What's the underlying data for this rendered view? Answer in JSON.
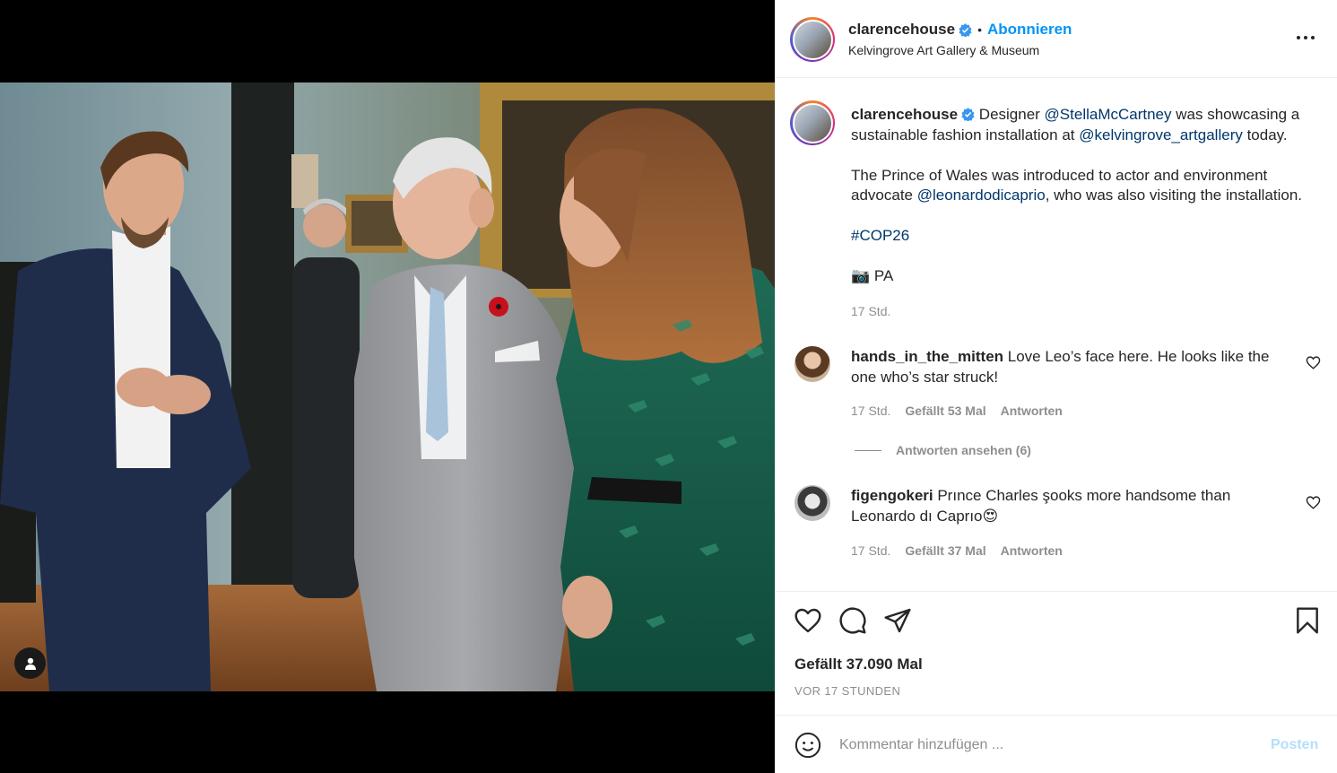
{
  "post": {
    "username": "clarencehouse",
    "follow_label": "Abonnieren",
    "separator": "•",
    "location": "Kelvingrove Art Gallery & Museum"
  },
  "caption": {
    "username": "clarencehouse",
    "p1_a": " Designer ",
    "p1_mention1": "@StellaMcCartney",
    "p1_b": " was showcasing a sustainable fashion installation at ",
    "p1_mention2": "@kelvingrove_artgallery",
    "p1_c": " today.",
    "p2_a": "The Prince of Wales was introduced to actor and environment advocate ",
    "p2_mention": "@leonardodicaprio",
    "p2_b": ", who was also visiting the installation.",
    "hashtag": "#COP26",
    "credit_emoji": "📷",
    "credit": " PA",
    "time": "17 Std."
  },
  "comments": [
    {
      "username": "hands_in_the_mitten",
      "text": " Love Leo’s face here. He looks like the one who’s star struck!",
      "time": "17 Std.",
      "likes": "Gefällt 53 Mal",
      "reply": "Antworten"
    },
    {
      "username": "figengokeri",
      "text": " Prınce Charles şooks more handsome than Leonardo dı Caprıo",
      "emoji": "😍",
      "time": "17 Std.",
      "likes": "Gefällt 37 Mal",
      "reply": "Antworten"
    }
  ],
  "view_replies": "Antworten ansehen (6)",
  "likes_total": "Gefällt 37.090 Mal",
  "post_date": "VOR 17 STUNDEN",
  "comment_placeholder": "Kommentar hinzufügen ...",
  "post_button": "Posten",
  "colors": {
    "accent": "#0095f6",
    "link": "#00376b",
    "muted": "#8e8e8e",
    "post_disabled": "#b2dffc"
  },
  "icons": [
    "heart-icon",
    "comment-icon",
    "share-icon",
    "bookmark-icon",
    "emoji-icon",
    "more-icon",
    "verified-icon",
    "user-tag-icon"
  ]
}
